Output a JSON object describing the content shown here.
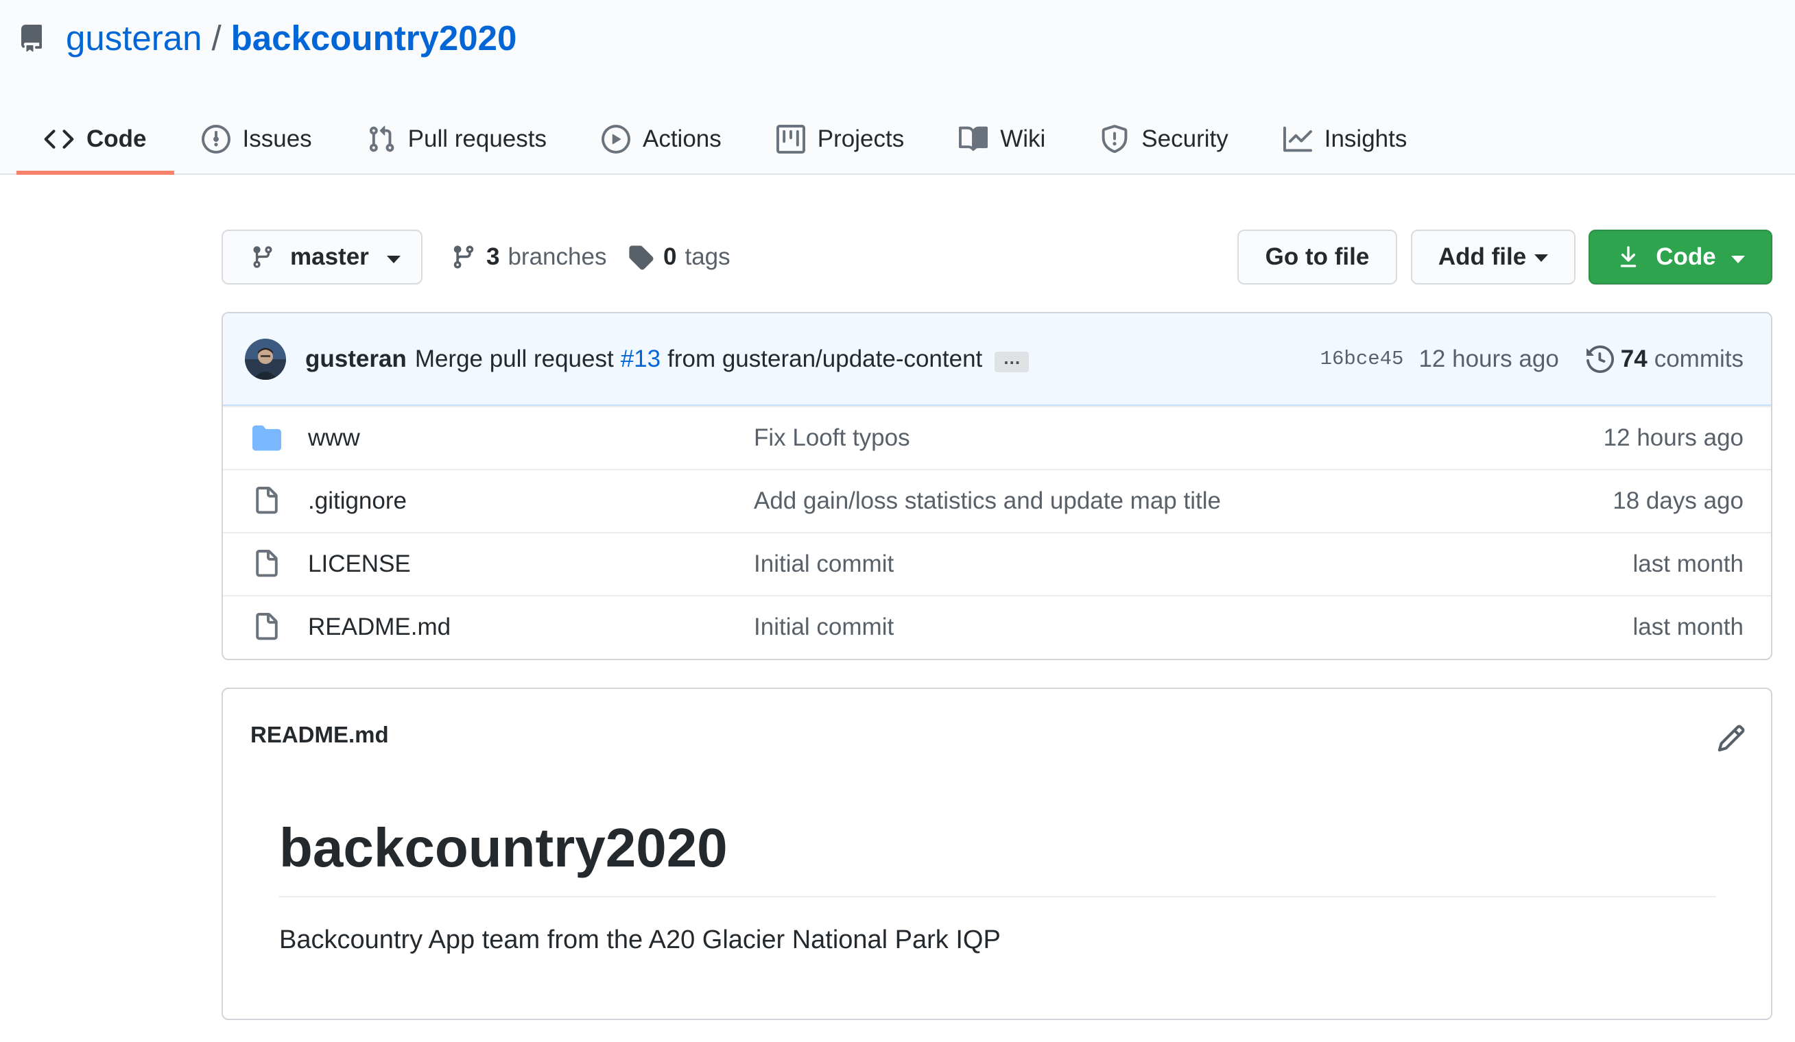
{
  "repo": {
    "owner": "gusteran",
    "separator": "/",
    "name": "backcountry2020"
  },
  "nav": {
    "tabs": [
      {
        "label": "Code",
        "icon": "code-icon",
        "selected": true
      },
      {
        "label": "Issues",
        "icon": "issue-icon"
      },
      {
        "label": "Pull requests",
        "icon": "pull-request-icon"
      },
      {
        "label": "Actions",
        "icon": "play-icon"
      },
      {
        "label": "Projects",
        "icon": "project-icon"
      },
      {
        "label": "Wiki",
        "icon": "book-icon"
      },
      {
        "label": "Security",
        "icon": "shield-icon"
      },
      {
        "label": "Insights",
        "icon": "graph-icon"
      }
    ]
  },
  "toolbar": {
    "branch": "master",
    "branches_count": "3",
    "branches_label": "branches",
    "tags_count": "0",
    "tags_label": "tags",
    "go_to_file": "Go to file",
    "add_file": "Add file",
    "code": "Code"
  },
  "commit": {
    "author": "gusteran",
    "message_prefix": "Merge pull request",
    "pr": "#13",
    "message_suffix": "from gusteran/update-content",
    "ellipsis": "…",
    "sha": "16bce45",
    "time": "12 hours ago",
    "commits_count": "74",
    "commits_label": "commits"
  },
  "files": [
    {
      "type": "directory",
      "icon": "folder-icon",
      "name": "www",
      "message": "Fix Looft typos",
      "age": "12 hours ago"
    },
    {
      "type": "file",
      "icon": "file-icon",
      "name": ".gitignore",
      "message": "Add gain/loss statistics and update map title",
      "age": "18 days ago"
    },
    {
      "type": "file",
      "icon": "file-icon",
      "name": "LICENSE",
      "message": "Initial commit",
      "age": "last month"
    },
    {
      "type": "file",
      "icon": "file-icon",
      "name": "README.md",
      "message": "Initial commit",
      "age": "last month"
    }
  ],
  "readme": {
    "filename": "README.md",
    "heading": "backcountry2020",
    "body": "Backcountry App team from the A20 Glacier National Park IQP"
  },
  "colors": {
    "link": "#0366d6",
    "primary_button": "#2ea44f",
    "selected_tab_underline": "#f9826c",
    "commit_bar_bg": "#f1f8ff",
    "folder": "#79b8ff"
  }
}
